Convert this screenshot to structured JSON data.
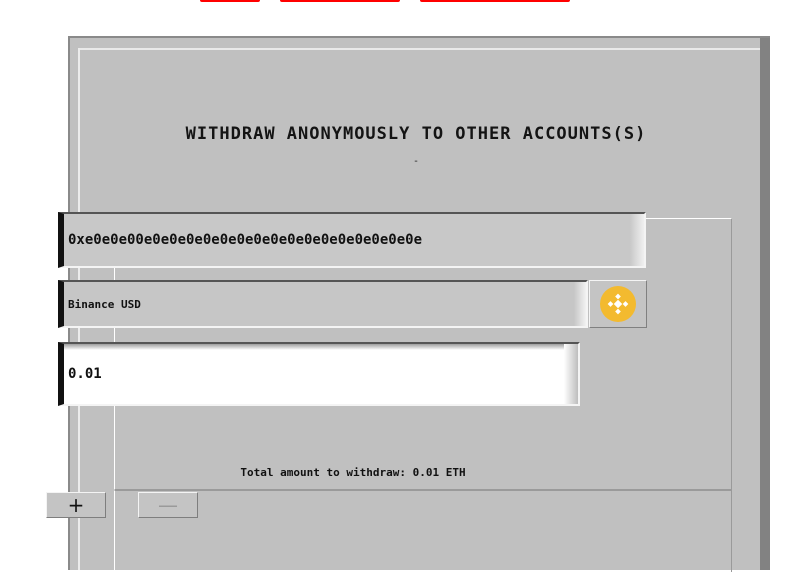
{
  "dialog": {
    "title": "WITHDRAW ANONYMOUSLY TO OTHER ACCOUNTS(S)",
    "subtitle": "-"
  },
  "form": {
    "address": "0xe0e0e00e0e0e0e0e0e0e0e0e0e0e0e0e0e0e0e0e",
    "token": "Binance USD",
    "token_icon": "bnb-icon",
    "amount": "0.01"
  },
  "summary": {
    "total_text": "Total amount to withdraw: 0.01 ETH"
  },
  "buttons": {
    "add_label": "+",
    "remove_label": "—"
  },
  "colors": {
    "window_bg": "#c0c0c0",
    "accent_yellow": "#f3ba2f",
    "red_banner": "#ff0000"
  }
}
